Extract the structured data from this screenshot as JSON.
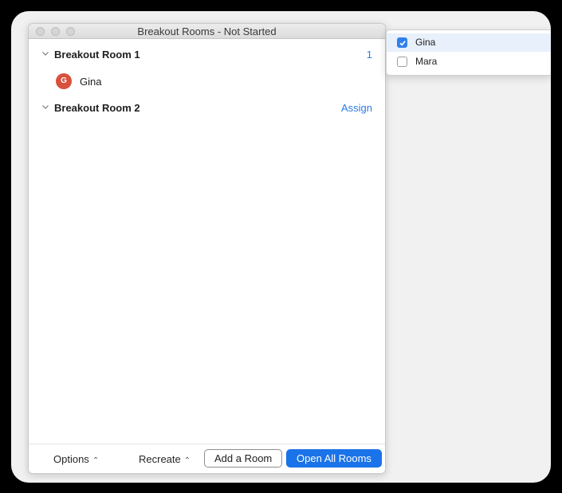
{
  "window": {
    "title": "Breakout Rooms - Not Started"
  },
  "rooms": [
    {
      "name": "Breakout Room 1",
      "action": "1",
      "participants": [
        {
          "initial": "G",
          "name": "Gina"
        }
      ]
    },
    {
      "name": "Breakout Room 2",
      "action": "Assign",
      "participants": []
    }
  ],
  "footer": {
    "options_label": "Options",
    "recreate_label": "Recreate",
    "add_room_label": "Add a Room",
    "open_all_label": "Open All Rooms"
  },
  "popover": {
    "items": [
      {
        "name": "Gina",
        "checked": true
      },
      {
        "name": "Mara",
        "checked": false
      }
    ]
  },
  "icons": {
    "chevron": "chevron-down-icon",
    "caret": "caret-up-icon",
    "checkbox": "checkbox-icon",
    "checkmark": "checkmark-icon"
  },
  "colors": {
    "accent": "#1a73e8",
    "link": "#2c7be5",
    "avatar": "#d9503c",
    "highlight": "#e8f0fb"
  }
}
